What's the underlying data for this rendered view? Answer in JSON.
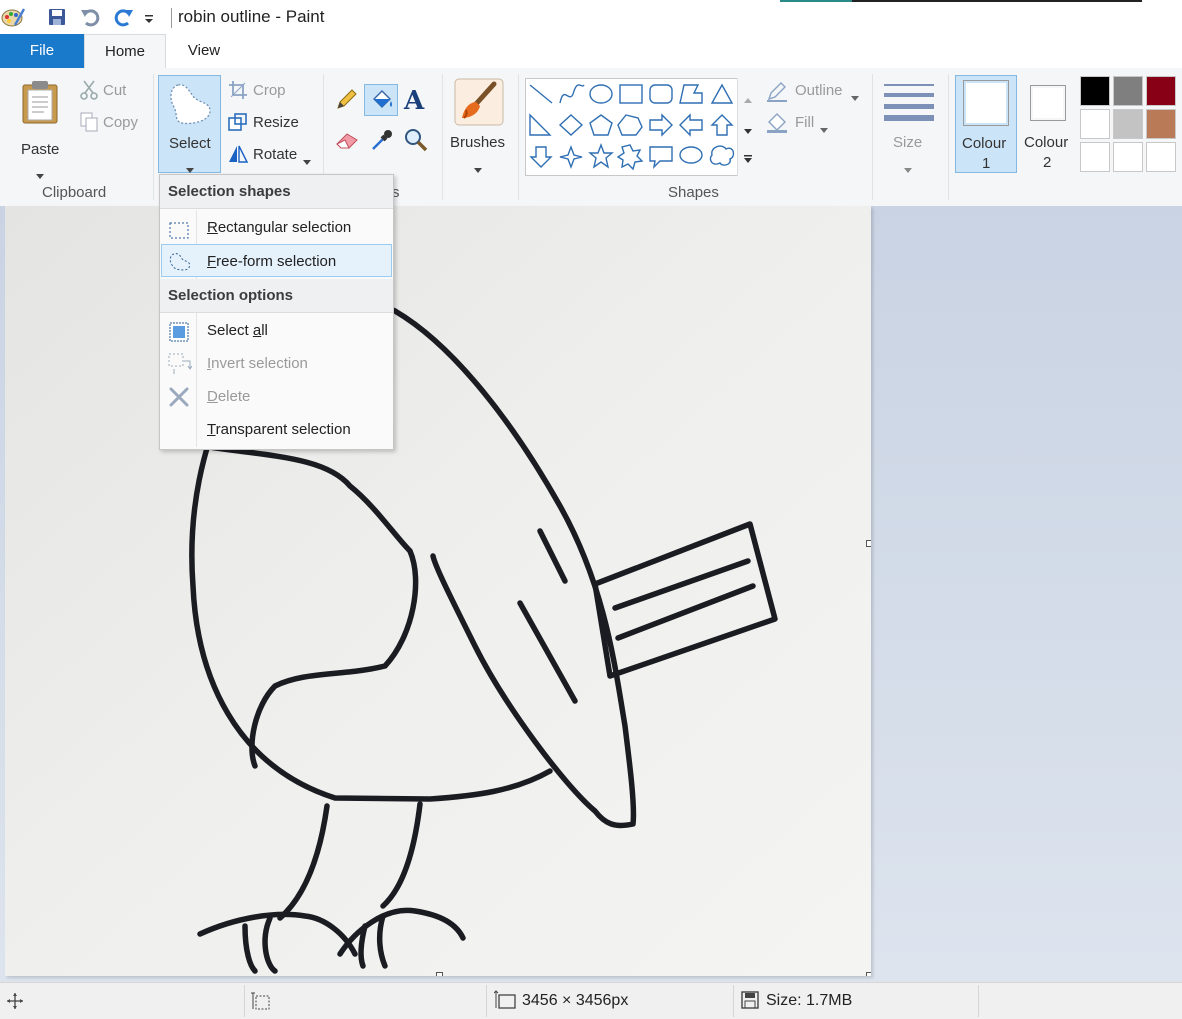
{
  "window": {
    "title": "robin outline - Paint"
  },
  "tabs": {
    "file": "File",
    "home": "Home",
    "view": "View"
  },
  "clipboard": {
    "paste": "Paste",
    "cut": "Cut",
    "copy": "Copy",
    "group": "Clipboard"
  },
  "image": {
    "select": "Select",
    "crop": "Crop",
    "resize": "Resize",
    "rotate": "Rotate",
    "group_partial": "s"
  },
  "tools": {
    "brushes": "Brushes"
  },
  "shapes": {
    "outline": "Outline",
    "fill": "Fill",
    "group": "Shapes"
  },
  "size": {
    "label": "Size"
  },
  "colours": {
    "colour1": "Colour",
    "colour1_num": "1",
    "colour2": "Colour",
    "colour2_num": "2",
    "colour1_value": "#ffffff",
    "colour2_value": "#ffffff",
    "palette": [
      "#000000",
      "#7f7f7f",
      "#880015",
      "#ffffff",
      "#c3c3c3",
      "#b97a57"
    ]
  },
  "dropdown": {
    "shapes_header": "Selection shapes",
    "rect_pre": "",
    "rect_u": "R",
    "rect_post": "ectangular selection",
    "free_pre": "",
    "free_u": "F",
    "free_post": "ree-form selection",
    "options_header": "Selection options",
    "all_pre": "Select ",
    "all_u": "a",
    "all_post": "ll",
    "invert_pre": "",
    "invert_u": "I",
    "invert_post": "nvert selection",
    "delete_pre": "",
    "delete_u": "D",
    "delete_post": "elete",
    "trans_pre": "",
    "trans_u": "T",
    "trans_post": "ransparent selection"
  },
  "status": {
    "dimensions": "3456 × 3456px",
    "size": "Size: 1.7MB"
  }
}
